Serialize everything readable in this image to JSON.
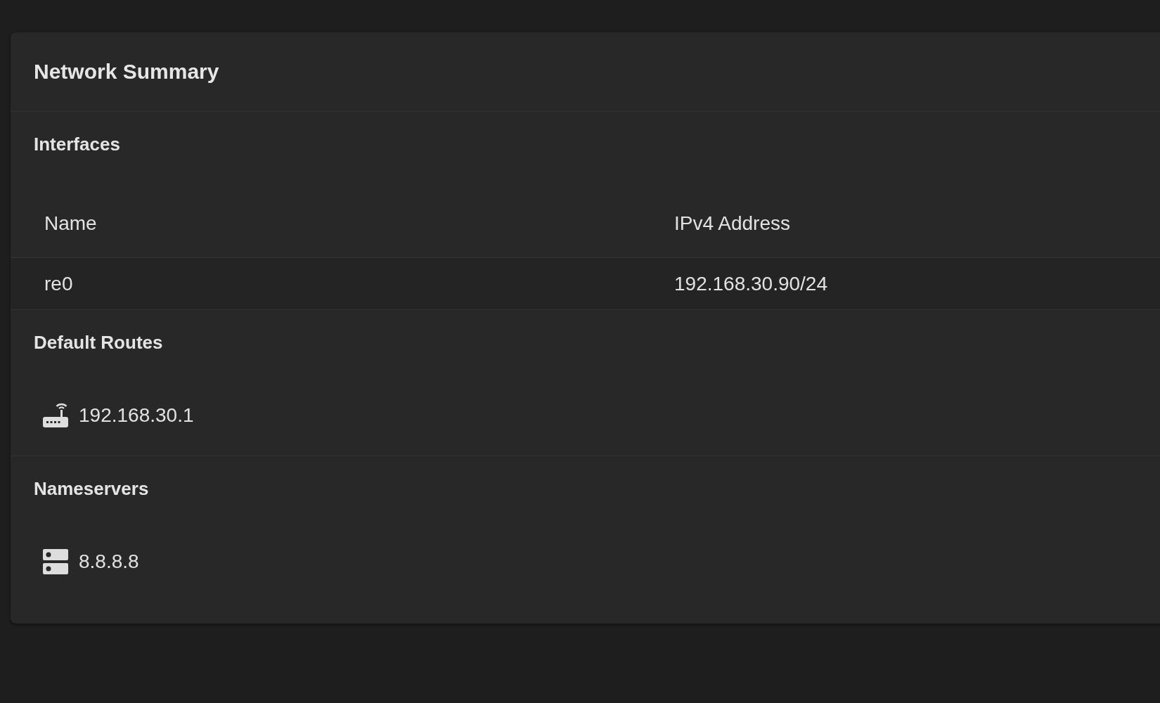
{
  "card_title": "Network Summary",
  "interfaces": {
    "heading": "Interfaces",
    "columns": [
      "Name",
      "IPv4 Address"
    ],
    "rows": [
      [
        "re0",
        "192.168.30.90/24"
      ]
    ]
  },
  "default_routes": {
    "heading": "Default Routes",
    "items": [
      "192.168.30.1"
    ]
  },
  "nameservers": {
    "heading": "Nameservers",
    "items": [
      "8.8.8.8"
    ]
  }
}
